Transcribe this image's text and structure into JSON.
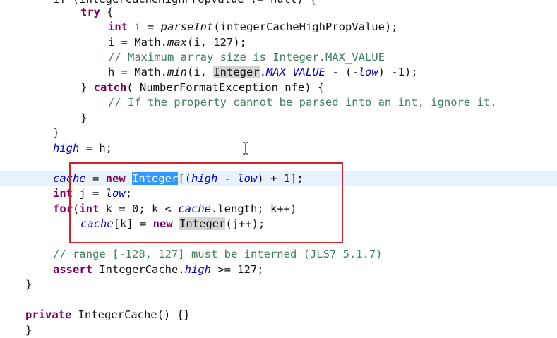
{
  "code": {
    "lines": [
      {
        "indent": "    ",
        "parts": [
          {
            "t": "if (integerCacheHighPropValue != null) {",
            "c": ""
          }
        ]
      },
      {
        "indent": "        ",
        "parts": [
          {
            "t": "try",
            "c": "kw"
          },
          {
            "t": " {",
            "c": ""
          }
        ]
      },
      {
        "indent": "            ",
        "parts": [
          {
            "t": "int",
            "c": "kw"
          },
          {
            "t": " i = ",
            "c": ""
          },
          {
            "t": "parseInt",
            "c": "mth"
          },
          {
            "t": "(integerCacheHighPropValue);",
            "c": ""
          }
        ]
      },
      {
        "indent": "            ",
        "parts": [
          {
            "t": "i = Math.",
            "c": ""
          },
          {
            "t": "max",
            "c": "mth"
          },
          {
            "t": "(i, 127);",
            "c": ""
          }
        ]
      },
      {
        "indent": "            ",
        "parts": [
          {
            "t": "// Maximum array size is Integer.MAX_VALUE",
            "c": "cm"
          }
        ]
      },
      {
        "indent": "            ",
        "parts": [
          {
            "t": "h = Math.",
            "c": ""
          },
          {
            "t": "min",
            "c": "mth"
          },
          {
            "t": "(i, ",
            "c": ""
          },
          {
            "t": "Integer",
            "c": "occ"
          },
          {
            "t": ".",
            "c": ""
          },
          {
            "t": "MAX_VALUE",
            "c": "fld"
          },
          {
            "t": " - (-",
            "c": ""
          },
          {
            "t": "low",
            "c": "fld"
          },
          {
            "t": ") -1);",
            "c": ""
          }
        ]
      },
      {
        "indent": "        ",
        "parts": [
          {
            "t": "} ",
            "c": ""
          },
          {
            "t": "catch",
            "c": "kw"
          },
          {
            "t": "( NumberFormatException nfe) {",
            "c": ""
          }
        ]
      },
      {
        "indent": "            ",
        "parts": [
          {
            "t": "// If the property cannot be parsed into an int, ignore it.",
            "c": "cm"
          }
        ]
      },
      {
        "indent": "        ",
        "parts": [
          {
            "t": "}",
            "c": ""
          }
        ]
      },
      {
        "indent": "    ",
        "parts": [
          {
            "t": "}",
            "c": ""
          }
        ]
      },
      {
        "indent": "    ",
        "parts": [
          {
            "t": "high",
            "c": "fld"
          },
          {
            "t": " = h;",
            "c": ""
          }
        ]
      },
      {
        "indent": "",
        "parts": []
      },
      {
        "indent": "    ",
        "current": true,
        "parts": [
          {
            "t": "cache",
            "c": "fld"
          },
          {
            "t": " = ",
            "c": ""
          },
          {
            "t": "new",
            "c": "kw"
          },
          {
            "t": " ",
            "c": ""
          },
          {
            "t": "Integer",
            "c": "sel"
          },
          {
            "t": "[(",
            "c": ""
          },
          {
            "t": "high",
            "c": "fld"
          },
          {
            "t": " - ",
            "c": ""
          },
          {
            "t": "low",
            "c": "fld"
          },
          {
            "t": ") + 1];",
            "c": ""
          }
        ]
      },
      {
        "indent": "    ",
        "parts": [
          {
            "t": "int",
            "c": "kw"
          },
          {
            "t": " j = ",
            "c": ""
          },
          {
            "t": "low",
            "c": "fld"
          },
          {
            "t": ";",
            "c": ""
          }
        ]
      },
      {
        "indent": "    ",
        "parts": [
          {
            "t": "for",
            "c": "kw"
          },
          {
            "t": "(",
            "c": ""
          },
          {
            "t": "int",
            "c": "kw"
          },
          {
            "t": " k = 0; k < ",
            "c": ""
          },
          {
            "t": "cache",
            "c": "fld"
          },
          {
            "t": ".length; k++)",
            "c": ""
          }
        ]
      },
      {
        "indent": "        ",
        "parts": [
          {
            "t": "cache",
            "c": "fld"
          },
          {
            "t": "[k] = ",
            "c": ""
          },
          {
            "t": "new",
            "c": "kw"
          },
          {
            "t": " ",
            "c": ""
          },
          {
            "t": "Integer",
            "c": "occ"
          },
          {
            "t": "(j++);",
            "c": ""
          }
        ]
      },
      {
        "indent": "",
        "parts": []
      },
      {
        "indent": "    ",
        "parts": [
          {
            "t": "// range [-128, 127] must be interned (JLS7 5.1.7)",
            "c": "cm"
          }
        ]
      },
      {
        "indent": "    ",
        "parts": [
          {
            "t": "assert",
            "c": "kw"
          },
          {
            "t": " IntegerCache.",
            "c": ""
          },
          {
            "t": "high",
            "c": "fld"
          },
          {
            "t": " >= 127;",
            "c": ""
          }
        ]
      },
      {
        "indent": "",
        "parts": [
          {
            "t": "}",
            "c": ""
          }
        ]
      },
      {
        "indent": "",
        "parts": []
      },
      {
        "indent": "",
        "parts": [
          {
            "t": "private",
            "c": "kw"
          },
          {
            "t": " IntegerCache() {}",
            "c": ""
          }
        ]
      },
      {
        "indent": "",
        "parts": [
          {
            "t": "}",
            "c": ""
          }
        ]
      }
    ]
  },
  "colors": {
    "keyword": "#7f0055",
    "field": "#0000c0",
    "comment": "#3f7f5f",
    "selection": "#3399ff",
    "current_line": "#e8f2fe",
    "annotation_box": "#d0232b"
  },
  "icons": {
    "mouse_cursor": "text-cursor-icon"
  }
}
